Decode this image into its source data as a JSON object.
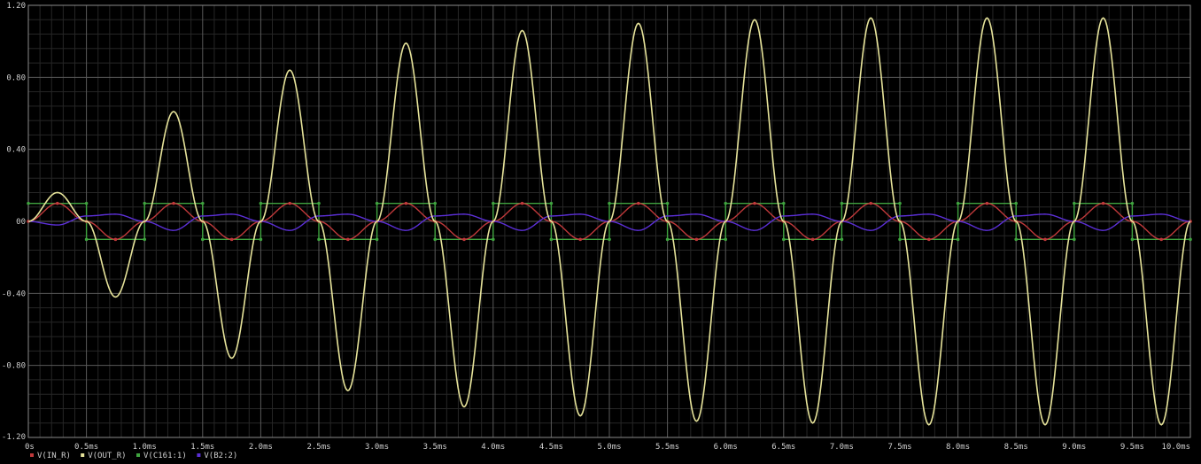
{
  "chart_data": {
    "type": "line",
    "xlim": [
      0,
      10
    ],
    "ylim": [
      -1.2,
      1.2
    ],
    "grid": true,
    "legend_position": "bottom-left",
    "x_ticks": [
      {
        "v": 0,
        "label": "0s"
      },
      {
        "v": 0.5,
        "label": "0.5ms"
      },
      {
        "v": 1.0,
        "label": "1.0ms"
      },
      {
        "v": 1.5,
        "label": "1.5ms"
      },
      {
        "v": 2.0,
        "label": "2.0ms"
      },
      {
        "v": 2.5,
        "label": "2.5ms"
      },
      {
        "v": 3.0,
        "label": "3.0ms"
      },
      {
        "v": 3.5,
        "label": "3.5ms"
      },
      {
        "v": 4.0,
        "label": "4.0ms"
      },
      {
        "v": 4.5,
        "label": "4.5ms"
      },
      {
        "v": 5.0,
        "label": "5.0ms"
      },
      {
        "v": 5.5,
        "label": "5.5ms"
      },
      {
        "v": 6.0,
        "label": "6.0ms"
      },
      {
        "v": 6.5,
        "label": "6.5ms"
      },
      {
        "v": 7.0,
        "label": "7.0ms"
      },
      {
        "v": 7.5,
        "label": "7.5ms"
      },
      {
        "v": 8.0,
        "label": "8.0ms"
      },
      {
        "v": 8.5,
        "label": "8.5ms"
      },
      {
        "v": 9.0,
        "label": "9.0ms"
      },
      {
        "v": 9.5,
        "label": "9.5ms"
      },
      {
        "v": 10.0,
        "label": "10.0ms"
      }
    ],
    "y_ticks": [
      {
        "v": 1.2,
        "label": "1.20"
      },
      {
        "v": 0.8,
        "label": "0.80"
      },
      {
        "v": 0.4,
        "label": "0.40"
      },
      {
        "v": 0,
        "label": "00"
      },
      {
        "v": -0.4,
        "label": "-0.40"
      },
      {
        "v": -0.8,
        "label": "-0.80"
      },
      {
        "v": -1.2,
        "label": "-1.20"
      }
    ],
    "series": [
      {
        "name": "V(IN_R)",
        "color": "#c0393b",
        "marker": "dot",
        "x": [
          0,
          0.25,
          0.5,
          0.75,
          1.0,
          1.25,
          1.5,
          1.75,
          2.0,
          2.25,
          2.5,
          2.75,
          3.0,
          3.25,
          3.5,
          3.75,
          4.0,
          4.25,
          4.5,
          4.75,
          5.0,
          5.25,
          5.5,
          5.75,
          6.0,
          6.25,
          6.5,
          6.75,
          7.0,
          7.25,
          7.5,
          7.75,
          8.0,
          8.25,
          8.5,
          8.75,
          9.0,
          9.25,
          9.5,
          9.75,
          10.0
        ],
        "y": [
          0,
          0.1,
          0,
          -0.1,
          0,
          0.1,
          0,
          -0.1,
          0,
          0.1,
          0,
          -0.1,
          0,
          0.1,
          0,
          -0.1,
          0,
          0.1,
          0,
          -0.1,
          0,
          0.1,
          0,
          -0.1,
          0,
          0.1,
          0,
          -0.1,
          0,
          0.1,
          0,
          -0.1,
          0,
          0.1,
          0,
          -0.1,
          0,
          0.1,
          0,
          -0.1,
          0
        ]
      },
      {
        "name": "V(OUT_R)",
        "color": "#e6e39a",
        "marker": "none",
        "x": [
          0,
          0.25,
          0.5,
          0.75,
          1.0,
          1.25,
          1.5,
          1.75,
          2.0,
          2.25,
          2.5,
          2.75,
          3.0,
          3.25,
          3.5,
          3.75,
          4.0,
          4.25,
          4.5,
          4.75,
          5.0,
          5.25,
          5.5,
          5.75,
          6.0,
          6.25,
          6.5,
          6.75,
          7.0,
          7.25,
          7.5,
          7.75,
          8.0,
          8.25,
          8.5,
          8.75,
          9.0,
          9.25,
          9.5,
          9.75,
          10.0
        ],
        "y": [
          0,
          0.16,
          0,
          -0.42,
          0,
          0.61,
          0,
          -0.76,
          0,
          0.84,
          0,
          -0.94,
          0,
          0.99,
          0,
          -1.03,
          0,
          1.06,
          0,
          -1.08,
          0,
          1.1,
          0,
          -1.11,
          0,
          1.12,
          0,
          -1.12,
          0,
          1.13,
          0,
          -1.13,
          0,
          1.13,
          0,
          -1.13,
          0,
          1.13,
          0,
          -1.13,
          0
        ]
      },
      {
        "name": "V(C161:1)",
        "color": "#3fa33f",
        "marker": "dot",
        "x": [
          0,
          0.5,
          0.5,
          1.0,
          1.0,
          1.5,
          1.5,
          2.0,
          2.0,
          2.5,
          2.5,
          3.0,
          3.0,
          3.5,
          3.5,
          4.0,
          4.0,
          4.5,
          4.5,
          5.0,
          5.0,
          5.5,
          5.5,
          6.0,
          6.0,
          6.5,
          6.5,
          7.0,
          7.0,
          7.5,
          7.5,
          8.0,
          8.0,
          8.5,
          8.5,
          9.0,
          9.0,
          9.5,
          9.5,
          10.0
        ],
        "y": [
          0.1,
          0.1,
          -0.1,
          -0.1,
          0.1,
          0.1,
          -0.1,
          -0.1,
          0.1,
          0.1,
          -0.1,
          -0.1,
          0.1,
          0.1,
          -0.1,
          -0.1,
          0.1,
          0.1,
          -0.1,
          -0.1,
          0.1,
          0.1,
          -0.1,
          -0.1,
          0.1,
          0.1,
          -0.1,
          -0.1,
          0.1,
          0.1,
          -0.1,
          -0.1,
          0.1,
          0.1,
          -0.1,
          -0.1,
          0.1,
          0.1,
          -0.1,
          -0.1
        ]
      },
      {
        "name": "V(B2:2)",
        "color": "#5b2fd6",
        "marker": "none",
        "x": [
          0,
          0.25,
          0.5,
          0.75,
          1.0,
          1.25,
          1.5,
          1.75,
          2.0,
          2.25,
          2.5,
          2.75,
          3.0,
          3.25,
          3.5,
          3.75,
          4.0,
          4.25,
          4.5,
          4.75,
          5.0,
          5.25,
          5.5,
          5.75,
          6.0,
          6.25,
          6.5,
          6.75,
          7.0,
          7.25,
          7.5,
          7.75,
          8.0,
          8.25,
          8.5,
          8.75,
          9.0,
          9.25,
          9.5,
          9.75,
          10.0
        ],
        "y": [
          0,
          -0.02,
          0.03,
          0.04,
          0,
          -0.05,
          0.03,
          0.04,
          0,
          -0.05,
          0.03,
          0.04,
          0,
          -0.05,
          0.03,
          0.04,
          0,
          -0.05,
          0.03,
          0.04,
          0,
          -0.05,
          0.03,
          0.04,
          0,
          -0.05,
          0.03,
          0.04,
          0,
          -0.05,
          0.03,
          0.04,
          0,
          -0.05,
          0.03,
          0.04,
          0,
          -0.05,
          0.03,
          0.04,
          0
        ]
      }
    ]
  },
  "colors": {
    "background": "#000000",
    "grid_major": "#5a5a5a",
    "grid_minor": "#262626",
    "axis_text": "#cfcfcf"
  }
}
